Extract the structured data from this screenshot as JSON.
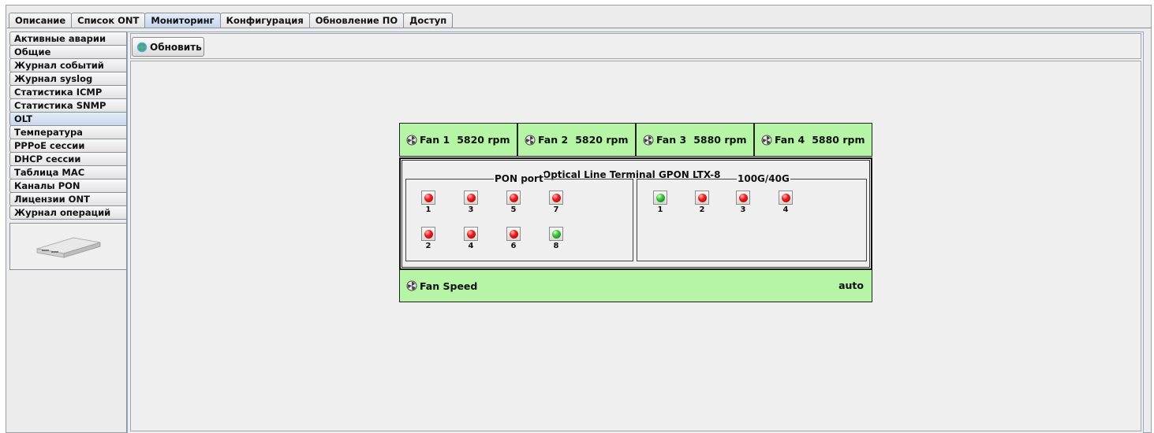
{
  "top_tabs": [
    {
      "label": "Описание",
      "active": false
    },
    {
      "label": "Список ONT",
      "active": false
    },
    {
      "label": "Мониторинг",
      "active": true
    },
    {
      "label": "Конфигурация",
      "active": false
    },
    {
      "label": "Обновление ПО",
      "active": false
    },
    {
      "label": "Доступ",
      "active": false
    }
  ],
  "side_tabs": [
    {
      "label": "Активные аварии",
      "active": false
    },
    {
      "label": "Общие",
      "active": false
    },
    {
      "label": "Журнал событий",
      "active": false
    },
    {
      "label": "Журнал syslog",
      "active": false
    },
    {
      "label": "Статистика ICMP",
      "active": false
    },
    {
      "label": "Статистика SNMP",
      "active": false
    },
    {
      "label": "OLT",
      "active": true
    },
    {
      "label": "Температура",
      "active": false
    },
    {
      "label": "PPPoE сессии",
      "active": false
    },
    {
      "label": "DHCP сессии",
      "active": false
    },
    {
      "label": "Таблица MAC",
      "active": false
    },
    {
      "label": "Каналы PON",
      "active": false
    },
    {
      "label": "Лицензии ONT",
      "active": false
    },
    {
      "label": "Журнал операций",
      "active": false
    }
  ],
  "toolbar": {
    "refresh_label": "Обновить",
    "refresh_icon": "refresh-icon"
  },
  "fans": [
    {
      "label": "Fan 1",
      "rpm": "5820 rpm"
    },
    {
      "label": "Fan 2",
      "rpm": "5820 rpm"
    },
    {
      "label": "Fan 3",
      "rpm": "5880 rpm"
    },
    {
      "label": "Fan 4",
      "rpm": "5880 rpm"
    }
  ],
  "olt": {
    "title": "Optical Line Terminal GPON LTX-8",
    "pon_group": {
      "label": "PON port",
      "ports": [
        {
          "num": "1",
          "status": "red"
        },
        {
          "num": "3",
          "status": "red"
        },
        {
          "num": "5",
          "status": "red"
        },
        {
          "num": "7",
          "status": "red"
        },
        {
          "num": "2",
          "status": "red"
        },
        {
          "num": "4",
          "status": "red"
        },
        {
          "num": "6",
          "status": "red"
        },
        {
          "num": "8",
          "status": "green"
        }
      ]
    },
    "uplink_group": {
      "label": "100G/40G",
      "ports": [
        {
          "num": "1",
          "status": "green"
        },
        {
          "num": "2",
          "status": "red"
        },
        {
          "num": "3",
          "status": "red"
        },
        {
          "num": "4",
          "status": "red"
        }
      ]
    }
  },
  "fan_speed": {
    "label": "Fan Speed",
    "value": "auto"
  },
  "colors": {
    "panel_green": "#b5f5a5",
    "led_red": "#ee2020",
    "led_green": "#3cc43c",
    "active_tab": "#c8d7ee"
  }
}
